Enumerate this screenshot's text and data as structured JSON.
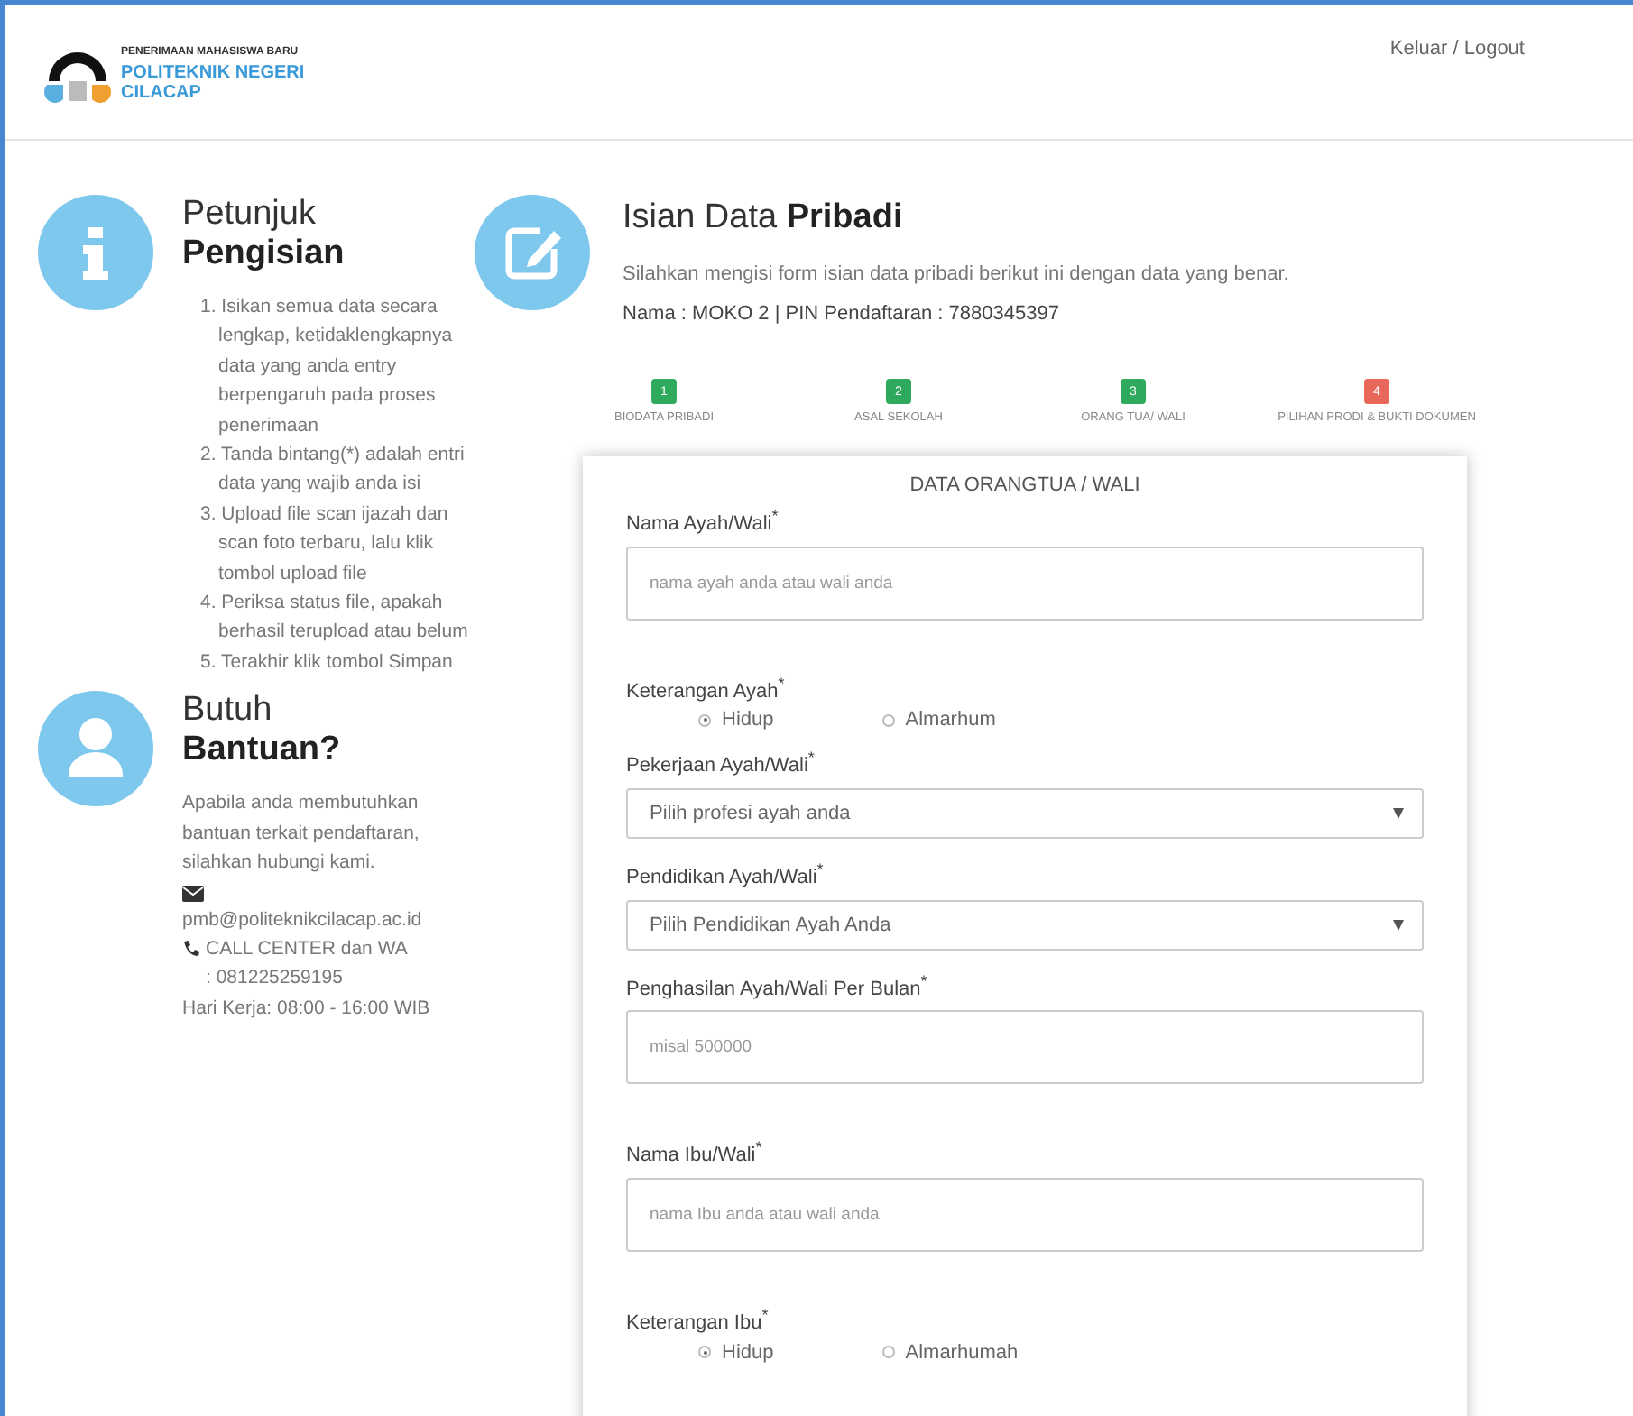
{
  "header": {
    "logo_subtitle": "PENERIMAAN MAHASISWA BARU",
    "logo_title": "POLITEKNIK NEGERI",
    "logo_title_2": "CILACAP",
    "logout": "Keluar / Logout"
  },
  "guide": {
    "title_light": "Petunjuk",
    "title_bold": "Pengisian",
    "items": [
      "1. Isikan semua data secara lengkap, ketidaklengkapnya data yang anda entry berpengaruh pada proses penerimaan",
      "2. Tanda bintang(*) adalah entri data yang wajib anda isi",
      "3. Upload file scan ijazah dan scan foto terbaru, lalu klik tombol upload file",
      "4. Periksa status file, apakah berhasil terupload atau belum",
      "5. Terakhir klik tombol Simpan"
    ]
  },
  "help": {
    "title_light": "Butuh",
    "title_bold": "Bantuan?",
    "text": "Apabila anda membutuhkan bantuan terkait pendaftaran, silahkan hubungi kami.",
    "email": "pmb@politeknikcilacap.ac.id",
    "call": "CALL CENTER dan WA : 081225259195",
    "hours": "Hari Kerja: 08:00 - 16:00 WIB"
  },
  "main": {
    "title_light": "Isian Data",
    "title_bold": "Pribadi",
    "intro": "Silahkan mengisi form isian data pribadi berikut ini dengan data yang benar.",
    "identity": "Nama : MOKO 2 | PIN Pendaftaran : 7880345397"
  },
  "steps": [
    {
      "number": "1",
      "label": "BIODATA PRIBADI",
      "color": "#2eaa5c"
    },
    {
      "number": "2",
      "label": "ASAL SEKOLAH",
      "color": "#2eaa5c"
    },
    {
      "number": "3",
      "label": "ORANG TUA/ WALI",
      "color": "#2eaa5c"
    },
    {
      "number": "4",
      "label": "PILIHAN PRODI & BUKTI DOKUMEN",
      "color": "#e8675a"
    }
  ],
  "form": {
    "title": "DATA ORANGTUA / WALI",
    "fields": [
      {
        "kind": "text",
        "label": "Nama Ayah/Wali$^{*}$",
        "placeholder": "nama ayah anda atau wali anda"
      },
      {
        "kind": "radio",
        "label": "Keterangan Ayah$^{*}$",
        "options": [
          {
            "label": "Hidup",
            "selected": true
          },
          {
            "label": "Almarhum",
            "selected": false
          }
        ]
      },
      {
        "kind": "select",
        "label": "Pekerjaan Ayah/Wali$^{*}$",
        "value": "Pilih profesi ayah anda"
      },
      {
        "kind": "select",
        "label": "Pendidikan Ayah/Wali$^{*}$",
        "value": "Pilih Pendidikan Ayah Anda"
      },
      {
        "kind": "text",
        "label": "Penghasilan Ayah/Wali Per Bulan$^{*}$",
        "placeholder": "misal 500000"
      },
      {
        "kind": "text",
        "label": "Nama Ibu/Wali$^{*}$",
        "placeholder": "nama Ibu anda atau wali anda"
      },
      {
        "kind": "radio",
        "label": "Keterangan Ibu$^{*}$",
        "options": [
          {
            "label": "Hidup",
            "selected": true
          },
          {
            "label": "Almarhumah",
            "selected": false
          }
        ]
      }
    ]
  }
}
